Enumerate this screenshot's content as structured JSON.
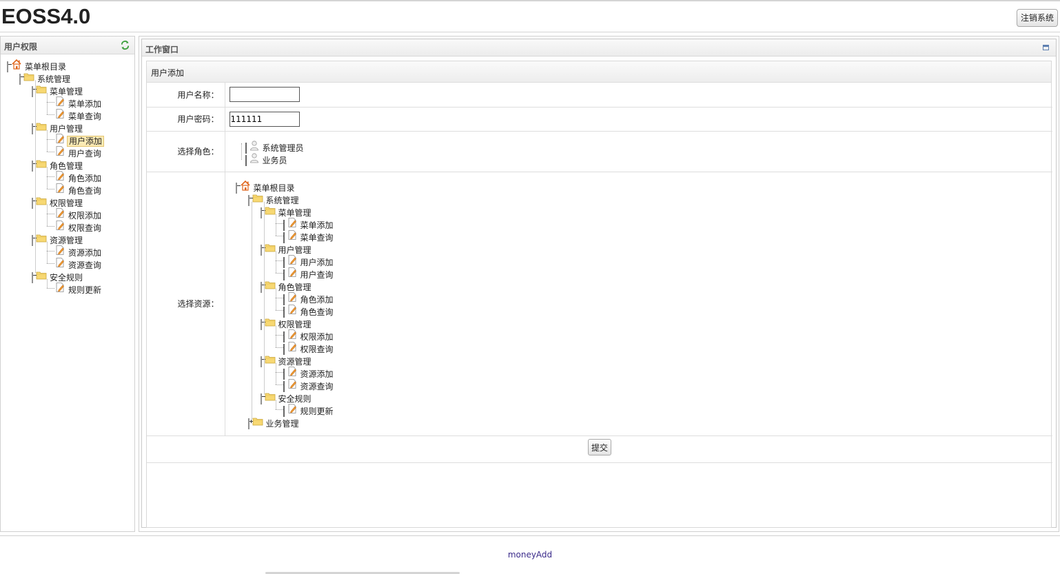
{
  "header": {
    "title": "EOSS4.0",
    "logout_label": "注销系统"
  },
  "left_panel": {
    "title": "用户权限",
    "tree": {
      "root": "菜单根目录",
      "system": "系统管理",
      "groups": [
        {
          "label": "菜单管理",
          "items": [
            "菜单添加",
            "菜单查询"
          ]
        },
        {
          "label": "用户管理",
          "items": [
            "用户添加",
            "用户查询"
          ]
        },
        {
          "label": "角色管理",
          "items": [
            "角色添加",
            "角色查询"
          ]
        },
        {
          "label": "权限管理",
          "items": [
            "权限添加",
            "权限查询"
          ]
        },
        {
          "label": "资源管理",
          "items": [
            "资源添加",
            "资源查询"
          ]
        },
        {
          "label": "安全规则",
          "items": [
            "规则更新"
          ]
        }
      ],
      "selected": "用户添加"
    }
  },
  "work_window": {
    "title": "工作窗口",
    "form_title": "用户添加",
    "fields": {
      "username_label": "用户名称：",
      "username_value": "",
      "password_label": "用户密码：",
      "password_value": "111111",
      "role_label": "选择角色：",
      "roles": [
        "系统管理员",
        "业务员"
      ],
      "resource_label": "选择资源：",
      "resource_tree": {
        "root": "菜单根目录",
        "system": "系统管理",
        "groups": [
          {
            "label": "菜单管理",
            "items": [
              "菜单添加",
              "菜单查询"
            ]
          },
          {
            "label": "用户管理",
            "items": [
              "用户添加",
              "用户查询"
            ]
          },
          {
            "label": "角色管理",
            "items": [
              "角色添加",
              "角色查询"
            ]
          },
          {
            "label": "权限管理",
            "items": [
              "权限添加",
              "权限查询"
            ]
          },
          {
            "label": "资源管理",
            "items": [
              "资源添加",
              "资源查询"
            ]
          },
          {
            "label": "安全规则",
            "items": [
              "规则更新"
            ]
          }
        ],
        "collapsed": "业务管理"
      }
    },
    "submit_label": "提交"
  },
  "footer": {
    "text": "moneyAdd"
  },
  "colors": {
    "selected_bg": "#fbeab4",
    "footer_text": "#3a2a8a"
  }
}
